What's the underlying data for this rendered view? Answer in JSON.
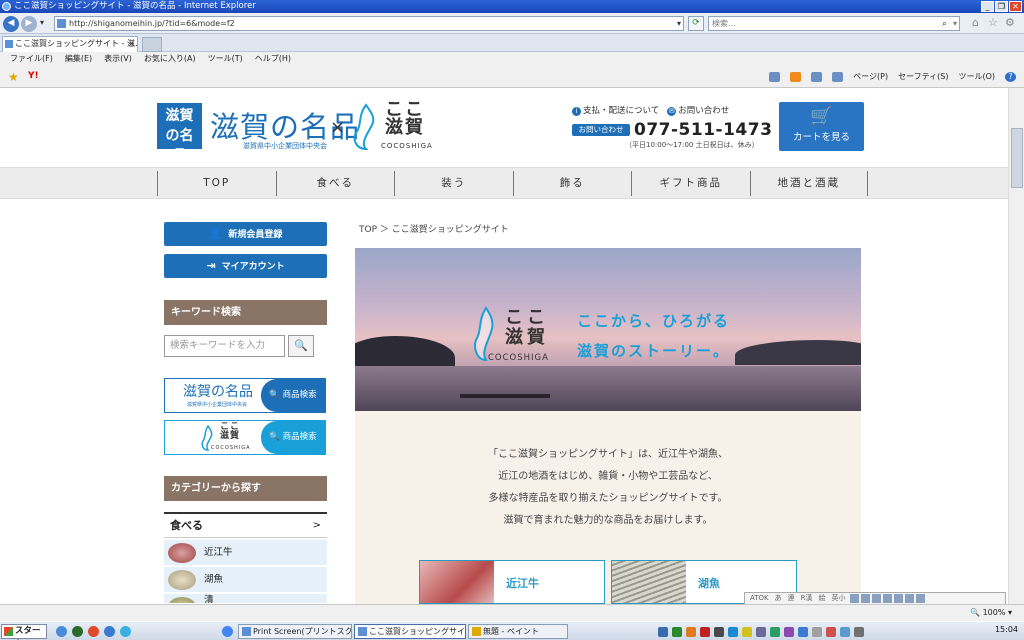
{
  "window": {
    "title": "ここ滋賀ショッピングサイト - 滋賀の名品 - Internet Explorer"
  },
  "browser": {
    "address": "http://shiganomeihin.jp/?tid=6&mode=f2",
    "search_placeholder": "検索...",
    "tab_label": "ここ滋賀ショッピングサイト - 滋...",
    "menu": [
      "ファイル(F)",
      "編集(E)",
      "表示(V)",
      "お気に入り(A)",
      "ツール(T)",
      "ヘルプ(H)"
    ],
    "command_bar": [
      "ページ(P)",
      "セーフティ(S)",
      "ツール(O)"
    ],
    "zoom": "100%"
  },
  "header": {
    "logo_mark": "滋賀の名品",
    "logo_title": "滋賀の名品",
    "logo_sub": "滋賀県中小企業団体中央会",
    "cross": "×",
    "coco_jp": "ここ\n滋賀",
    "coco_en": "COCOSHIGA",
    "link_payment": "支払・配送について",
    "link_contact": "お問い合わせ",
    "contact_badge": "お問い合わせ",
    "phone": "077-511-1473",
    "hours": "（平日10:00～17:00 土日祝日は、休み）",
    "cart_label": "カートを見る"
  },
  "nav": [
    "TOP",
    "食べる",
    "装う",
    "飾る",
    "ギフト商品",
    "地酒と酒蔵"
  ],
  "sidebar": {
    "register": "新規会員登録",
    "account": "マイアカウント",
    "keyword_head": "キーワード検索",
    "keyword_placeholder": "検索キーワードを入力",
    "banner1_logo": "滋賀の名品",
    "banner1_sub": "滋賀県中小企業団体中央会",
    "banner_button": "商品検索",
    "banner2_jp": "ここ\n滋賀",
    "banner2_en": "COCOSHIGA",
    "category_head": "カテゴリーから探す",
    "category": "食べる",
    "chevron": ">",
    "subcategories": [
      "近江牛",
      "湖魚",
      "漬"
    ]
  },
  "main": {
    "breadcrumb": "TOP ＞ ここ滋賀ショッピングサイト",
    "hero_jp": "ここ\n滋賀",
    "hero_en": "COCOSHIGA",
    "hero_line1": "ここから、ひろがる",
    "hero_line2": "滋賀のストーリー。",
    "intro": [
      "「ここ滋賀ショッピングサイト」は、近江牛や湖魚、",
      "近江の地酒をはじめ、雑貨・小物や工芸品など、",
      "多様な特産品を取り揃えたショッピングサイトです。",
      "滋賀で育まれた魅力的な商品をお届けします。"
    ],
    "features": [
      "近江牛",
      "湖魚"
    ]
  },
  "ime": [
    "ATOK",
    "あ",
    "連",
    "R漢",
    "絵",
    "英小"
  ],
  "taskbar": {
    "start": "スタート",
    "tasks": [
      "Print Screen(プリントスクリ...",
      "ここ滋賀ショッピングサイ...",
      "無題 - ペイント"
    ],
    "clock": "15:04"
  }
}
